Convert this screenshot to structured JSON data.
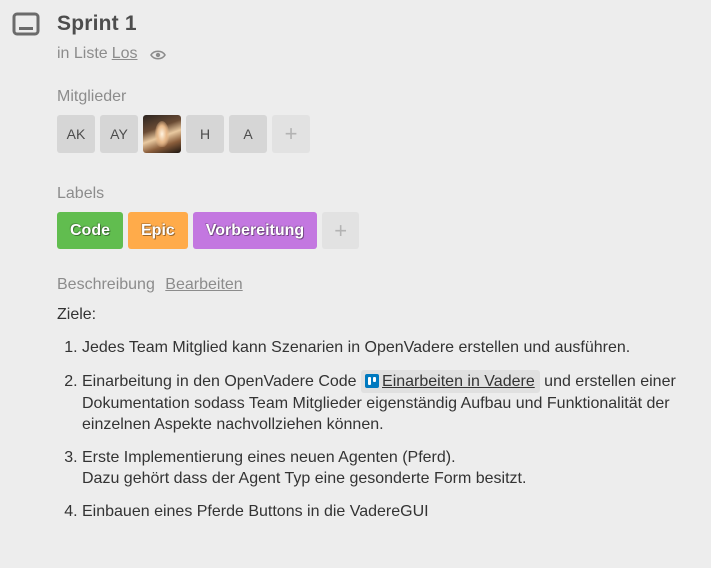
{
  "card": {
    "title": "Sprint 1",
    "list_prefix": "in Liste",
    "list_name": "Los"
  },
  "members": {
    "heading": "Mitglieder",
    "items": [
      {
        "initials": "AK",
        "type": "initials"
      },
      {
        "initials": "AY",
        "type": "initials"
      },
      {
        "initials": "",
        "type": "photo"
      },
      {
        "initials": "H",
        "type": "initials"
      },
      {
        "initials": "A",
        "type": "initials"
      }
    ],
    "add_glyph": "+"
  },
  "labels": {
    "heading": "Labels",
    "items": [
      {
        "text": "Code",
        "color": "#61bd4f"
      },
      {
        "text": "Epic",
        "color": "#ffab4a"
      },
      {
        "text": "Vorbereitung",
        "color": "#c377e0"
      }
    ],
    "add_glyph": "+"
  },
  "description": {
    "heading": "Beschreibung",
    "edit_label": "Bearbeiten",
    "intro": "Ziele:",
    "item1": "Jedes Team Mitglied kann Szenarien in OpenVadere erstellen und ausführen.",
    "item2_before": "Einarbeitung in den OpenVadere Code ",
    "item2_link": "Einarbeiten in Vadere",
    "item2_after": " und erstellen einer Dokumentation sodass Team Mitglieder eigenständig Aufbau und Funktionalität der einzelnen Aspekte nachvollziehen können.",
    "item3_line1": "Erste Implementierung eines neuen Agenten (Pferd).",
    "item3_line2": "Dazu gehört dass der Agent Typ eine gesonderte Form besitzt.",
    "item4": "Einbauen eines Pferde Buttons in die VadereGUI"
  },
  "icons": {
    "card": "card-icon",
    "watch": "eye-icon",
    "linked_card": "trello-icon"
  }
}
